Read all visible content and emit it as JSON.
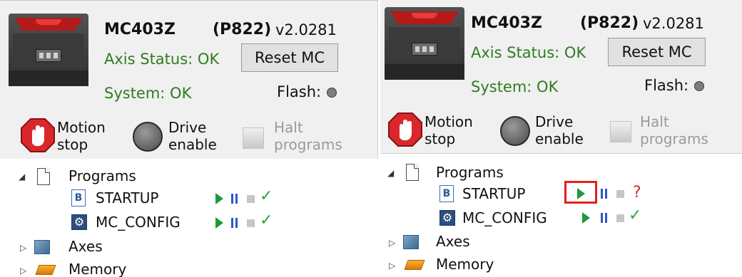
{
  "panels": [
    {
      "device": {
        "model": "MC403Z",
        "code": "(P822)",
        "version": "v2.0281"
      },
      "axis_status": "Axis Status: OK",
      "system_status": "System: OK",
      "reset_label": "Reset MC",
      "flash_label": "Flash:",
      "buttons": {
        "motion_stop": {
          "line1": "Motion",
          "line2": "stop"
        },
        "drive_enable": {
          "line1": "Drive",
          "line2": "enable"
        },
        "halt_programs": {
          "line1": "Halt",
          "line2": "programs"
        }
      },
      "tree": {
        "programs_label": "Programs",
        "programs": [
          {
            "name": "STARTUP",
            "icon": "basic-program-icon",
            "status": "ok"
          },
          {
            "name": "MC_CONFIG",
            "icon": "config-gear-icon",
            "status": "ok"
          }
        ],
        "axes_label": "Axes",
        "memory_label": "Memory"
      }
    },
    {
      "device": {
        "model": "MC403Z",
        "code": "(P822)",
        "version": "v2.0281"
      },
      "axis_status": "Axis Status: OK",
      "system_status": "System: OK",
      "reset_label": "Reset MC",
      "flash_label": "Flash:",
      "buttons": {
        "motion_stop": {
          "line1": "Motion",
          "line2": "stop"
        },
        "drive_enable": {
          "line1": "Drive",
          "line2": "enable"
        },
        "halt_programs": {
          "line1": "Halt",
          "line2": "programs"
        }
      },
      "tree": {
        "programs_label": "Programs",
        "programs": [
          {
            "name": "STARTUP",
            "icon": "basic-program-icon",
            "status": "?"
          },
          {
            "name": "MC_CONFIG",
            "icon": "config-gear-icon",
            "status": "ok"
          }
        ],
        "axes_label": "Axes",
        "memory_label": "Memory"
      },
      "highlight": {
        "target": "STARTUP play button",
        "color": "#e4211b"
      }
    }
  ],
  "colors": {
    "status_green": "#2e7d1e",
    "play_green": "#1f9a3a",
    "pause_blue": "#2f56c8",
    "check_green": "#2ea836",
    "question_red": "#d22a2a"
  }
}
